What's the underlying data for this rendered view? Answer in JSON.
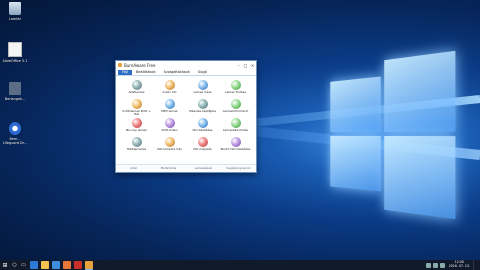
{
  "desktop": {
    "icons": [
      {
        "label": "Lomtár",
        "icon": "recycle-bin-icon"
      },
      {
        "label": "LibreOffice 5.1",
        "icon": "document-icon"
      },
      {
        "label": "Barlangok...",
        "icon": "application-icon"
      },
      {
        "label": "Bem... Lifeguard Dr...",
        "icon": "app-circle-icon"
      }
    ]
  },
  "app_window": {
    "title": "BurnAware Free",
    "menus": [
      {
        "label": "Fájl",
        "active": true
      },
      {
        "label": "Beállítások",
        "active": false
      },
      {
        "label": "Szolgáltatások",
        "active": false
      },
      {
        "label": "Súgó",
        "active": false
      }
    ],
    "tiles": [
      {
        "label": "Adatlemez",
        "color": "grad1"
      },
      {
        "label": "Audio CD",
        "color": "grad2"
      },
      {
        "label": "Lemez írása",
        "color": "grad3"
      },
      {
        "label": "Lemez törlése",
        "color": "grad4"
      },
      {
        "label": "Indítólemez DVD + ISO",
        "color": "grad2"
      },
      {
        "label": "MP3 lemez",
        "color": "grad3"
      },
      {
        "label": "Másolás képfájlba",
        "color": "grad1"
      },
      {
        "label": "Lemezinformáció",
        "color": "grad4"
      },
      {
        "label": "Blu-ray lemez",
        "color": "grad5"
      },
      {
        "label": "DVD-Video",
        "color": "grad6"
      },
      {
        "label": "ISO készítése",
        "color": "grad3"
      },
      {
        "label": "Lemezellenőrzés",
        "color": "grad4"
      },
      {
        "label": "Többlemezes",
        "color": "grad1"
      },
      {
        "label": "ISO lemezre írás",
        "color": "grad2"
      },
      {
        "label": "ISO másolás",
        "color": "grad5"
      },
      {
        "label": "Bontó ISO készítése",
        "color": "grad6"
      }
    ],
    "footer": [
      "Adat",
      "Multimédia",
      "Lemezképek",
      "Segédprogramok"
    ]
  },
  "taskbar": {
    "clock_time": "12:00",
    "clock_date": "2016. 07. 13."
  }
}
